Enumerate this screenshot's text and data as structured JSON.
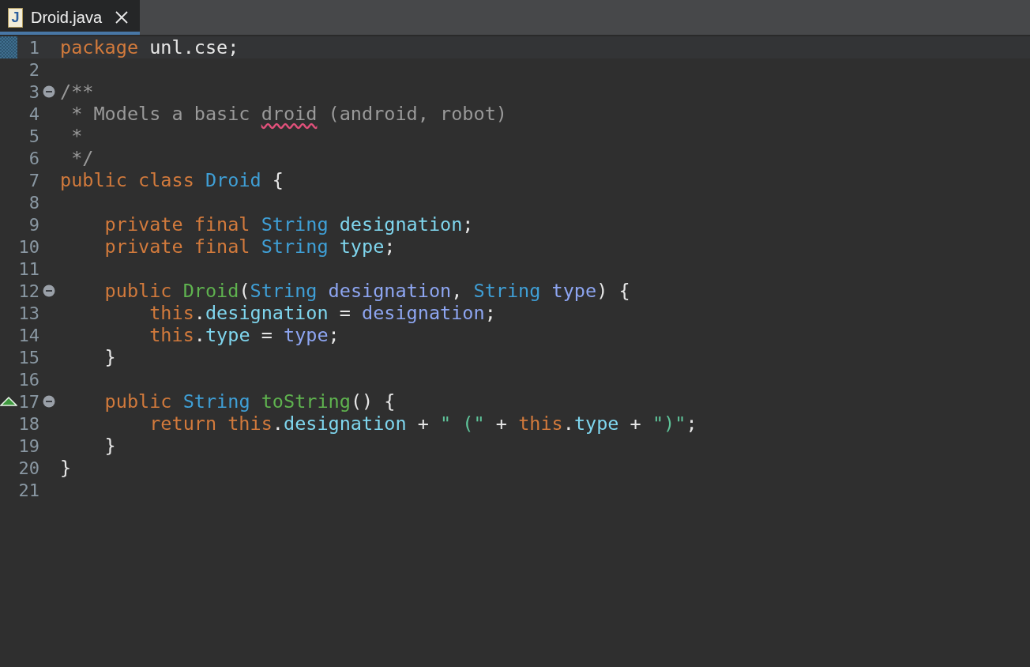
{
  "tabs": [
    {
      "label": "Droid.java",
      "icon": "J",
      "selected": true
    }
  ],
  "editor": {
    "lines": [
      {
        "number": "1",
        "current": true,
        "tokens": [
          {
            "kind": "keyword",
            "text": "package"
          },
          {
            "kind": "plain",
            "text": " unl.cse;"
          }
        ]
      },
      {
        "number": "2",
        "current": false
      },
      {
        "number": "3",
        "current": false,
        "fold_expanded": true,
        "tokens": [
          {
            "kind": "comment",
            "text": "/**"
          }
        ]
      },
      {
        "number": "4",
        "current": false,
        "tokens": [
          {
            "kind": "comment",
            "text": " * Models a basic "
          },
          {
            "kind": "misspelled",
            "text": "droid"
          },
          {
            "kind": "comment",
            "text": " (android, robot)"
          }
        ]
      },
      {
        "number": "5",
        "current": false,
        "tokens": [
          {
            "kind": "comment",
            "text": " *"
          }
        ]
      },
      {
        "number": "6",
        "current": false,
        "tokens": [
          {
            "kind": "comment",
            "text": " */"
          }
        ]
      },
      {
        "number": "7",
        "current": false,
        "tokens": [
          {
            "kind": "keyword",
            "text": "public class "
          },
          {
            "kind": "type",
            "text": "Droid"
          },
          {
            "kind": "plain",
            "text": " {"
          }
        ]
      },
      {
        "number": "8",
        "current": false
      },
      {
        "number": "9",
        "current": false,
        "tokens": [
          {
            "kind": "keyword",
            "text": "    private final "
          },
          {
            "kind": "type",
            "text": "String "
          },
          {
            "kind": "field",
            "text": "designation"
          },
          {
            "kind": "plain",
            "text": ";"
          }
        ]
      },
      {
        "number": "10",
        "current": false,
        "tokens": [
          {
            "kind": "keyword",
            "text": "    private final "
          },
          {
            "kind": "type",
            "text": "String "
          },
          {
            "kind": "field",
            "text": "type"
          },
          {
            "kind": "plain",
            "text": ";"
          }
        ]
      },
      {
        "number": "11",
        "current": false
      },
      {
        "number": "12",
        "current": false,
        "fold_expanded": true,
        "tokens": [
          {
            "kind": "keyword",
            "text": "    public "
          },
          {
            "kind": "method",
            "text": "Droid"
          },
          {
            "kind": "plain",
            "text": "("
          },
          {
            "kind": "type",
            "text": "String "
          },
          {
            "kind": "param",
            "text": "designation"
          },
          {
            "kind": "plain",
            "text": ", "
          },
          {
            "kind": "type",
            "text": "String "
          },
          {
            "kind": "param",
            "text": "type"
          },
          {
            "kind": "plain",
            "text": ") {"
          }
        ]
      },
      {
        "number": "13",
        "current": false,
        "tokens": [
          {
            "kind": "keyword",
            "text": "        this"
          },
          {
            "kind": "plain",
            "text": "."
          },
          {
            "kind": "field",
            "text": "designation"
          },
          {
            "kind": "plain",
            "text": " = "
          },
          {
            "kind": "param",
            "text": "designation"
          },
          {
            "kind": "plain",
            "text": ";"
          }
        ]
      },
      {
        "number": "14",
        "current": false,
        "tokens": [
          {
            "kind": "keyword",
            "text": "        this"
          },
          {
            "kind": "plain",
            "text": "."
          },
          {
            "kind": "field",
            "text": "type"
          },
          {
            "kind": "plain",
            "text": " = "
          },
          {
            "kind": "param",
            "text": "type"
          },
          {
            "kind": "plain",
            "text": ";"
          }
        ]
      },
      {
        "number": "15",
        "current": false,
        "tokens": [
          {
            "kind": "plain",
            "text": "    }"
          }
        ]
      },
      {
        "number": "16",
        "current": false
      },
      {
        "number": "17",
        "current": false,
        "fold_expanded": true,
        "override": true,
        "tokens": [
          {
            "kind": "keyword",
            "text": "    public "
          },
          {
            "kind": "type",
            "text": "String "
          },
          {
            "kind": "method",
            "text": "toString"
          },
          {
            "kind": "plain",
            "text": "() {"
          }
        ]
      },
      {
        "number": "18",
        "current": false,
        "tokens": [
          {
            "kind": "keyword",
            "text": "        return this"
          },
          {
            "kind": "plain",
            "text": "."
          },
          {
            "kind": "field",
            "text": "designation"
          },
          {
            "kind": "plain",
            "text": " + "
          },
          {
            "kind": "string",
            "text": "\" (\""
          },
          {
            "kind": "plain",
            "text": " + "
          },
          {
            "kind": "keyword",
            "text": "this"
          },
          {
            "kind": "plain",
            "text": "."
          },
          {
            "kind": "field",
            "text": "type"
          },
          {
            "kind": "plain",
            "text": " + "
          },
          {
            "kind": "string",
            "text": "\")\""
          },
          {
            "kind": "plain",
            "text": ";"
          }
        ]
      },
      {
        "number": "19",
        "current": false,
        "tokens": [
          {
            "kind": "plain",
            "text": "    }"
          }
        ]
      },
      {
        "number": "20",
        "current": false,
        "tokens": [
          {
            "kind": "plain",
            "text": "}"
          }
        ]
      },
      {
        "number": "21",
        "current": false
      }
    ]
  }
}
